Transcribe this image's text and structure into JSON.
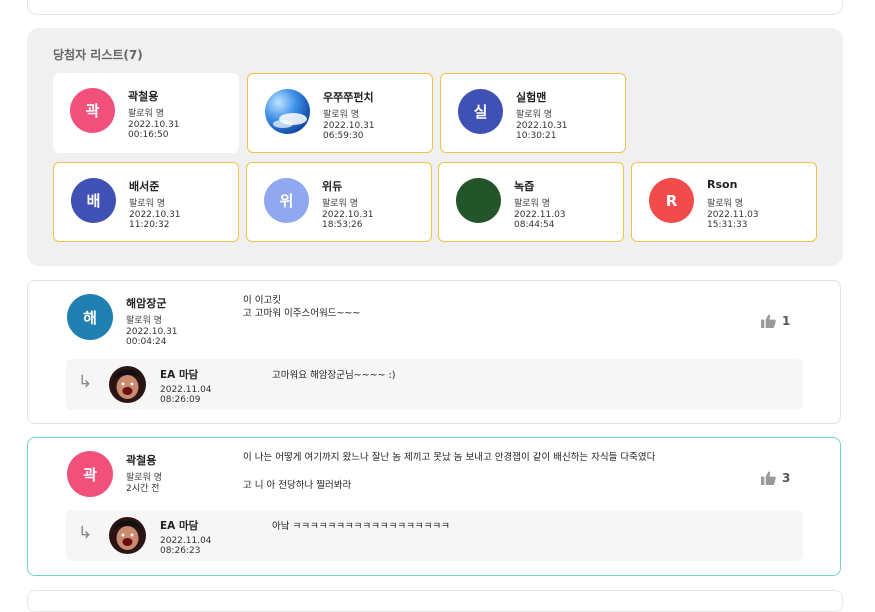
{
  "winners": {
    "title": "당첨자 리스트(7)",
    "items": [
      {
        "name": "곽철용",
        "avatar_text": "곽",
        "avatar_color": "#f0507a",
        "follow": "팔로워 명",
        "date": "2022.10.31",
        "time": "00:16:50"
      },
      {
        "name": "우쭈쭈펀치",
        "avatar_text": "",
        "avatar_color": "#2b7fd8",
        "follow": "팔로워 명",
        "date": "2022.10.31",
        "time": "06:59:30"
      },
      {
        "name": "실험맨",
        "avatar_text": "실",
        "avatar_color": "#3f51b5",
        "follow": "팔로워 명",
        "date": "2022.10.31",
        "time": "10:30:21"
      },
      {
        "name": "배서준",
        "avatar_text": "배",
        "avatar_color": "#3f51b5",
        "follow": "팔로워 명",
        "date": "2022.10.31",
        "time": "11:20:32"
      },
      {
        "name": "위듀",
        "avatar_text": "위",
        "avatar_color": "#8fa8ef",
        "follow": "팔로워 명",
        "date": "2022.10.31",
        "time": "18:53:26"
      },
      {
        "name": "녹즙",
        "avatar_text": "",
        "avatar_color": "#24542a",
        "follow": "팔로워 명",
        "date": "2022.11.03",
        "time": "08:44:54"
      },
      {
        "name": "Rson",
        "avatar_text": "R",
        "avatar_color": "#f24b4b",
        "follow": "팔로워 명",
        "date": "2022.11.03",
        "time": "15:31:33"
      }
    ]
  },
  "comments": [
    {
      "name": "해암장군",
      "avatar_text": "해",
      "avatar_color": "#1f7fb0",
      "follow": "팔로워 명",
      "date": "2022.10.31",
      "time": "00:04:24",
      "text_lines": [
        "이 이고킷",
        "고 고마워 이주스어워드~~~"
      ],
      "likes": "1",
      "reply": {
        "name": "EA 마담",
        "date": "2022.11.04",
        "time": "08:26:09",
        "text": "고마워요 해암장군님~~~~ :)"
      }
    },
    {
      "name": "곽철용",
      "avatar_text": "곽",
      "avatar_color": "#f0507a",
      "follow": "팔로워 명",
      "date": "2시간 전",
      "time": "",
      "text_lines": [
        "이 나는 어떻게 여기까지 왔느나 잘난 놈 제끼고 못났 놈 보내고 안경잽이 같이 배신하는 자식들 다죽였다",
        "고 니 아 전당하나 찔러봐라"
      ],
      "likes": "3",
      "reply": {
        "name": "EA 마담",
        "date": "2022.11.04",
        "time": "08:26:23",
        "text": "아낰 ㅋㅋㅋㅋㅋㅋㅋㅋㅋㅋㅋㅋㅋㅋㅋㅋㅋㅋ"
      }
    }
  ]
}
